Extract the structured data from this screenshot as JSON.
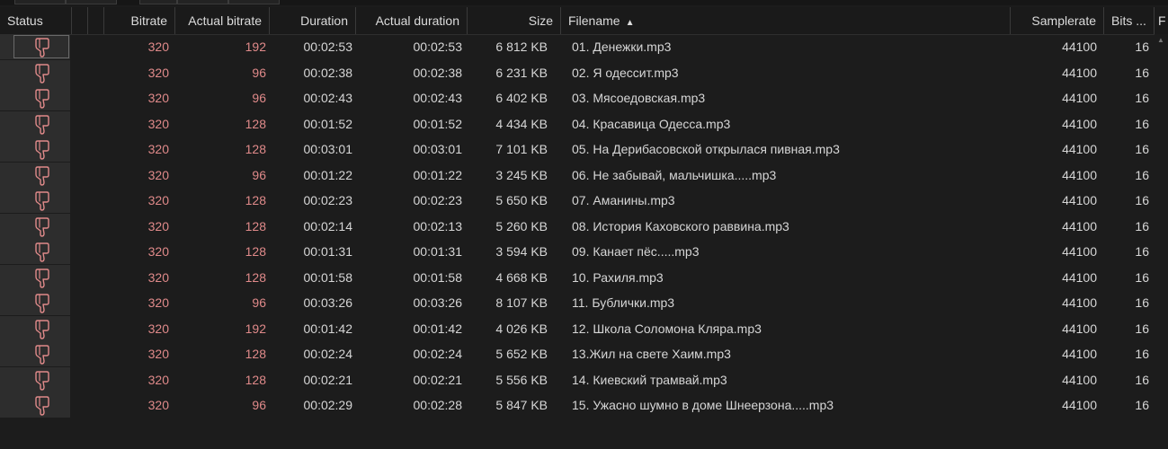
{
  "columns": {
    "status": "Status",
    "bitrate": "Bitrate",
    "actual_bitrate": "Actual bitrate",
    "duration": "Duration",
    "actual_duration": "Actual duration",
    "size": "Size",
    "filename": "Filename",
    "filename_sort": "▲",
    "samplerate": "Samplerate",
    "bits": "Bits ...",
    "overflow": "F"
  },
  "status_icon": "thumbs-down-icon",
  "colors": {
    "bitrate_text": "#e08a8a",
    "icon_stroke": "#e08a8a",
    "background": "#1c1c1c"
  },
  "rows": [
    {
      "bitrate": "320",
      "actual_bitrate": "192",
      "duration": "00:02:53",
      "actual_duration": "00:02:53",
      "size": "6 812 KB",
      "filename": "01. Денежки.mp3",
      "samplerate": "44100",
      "bits": "16"
    },
    {
      "bitrate": "320",
      "actual_bitrate": "96",
      "duration": "00:02:38",
      "actual_duration": "00:02:38",
      "size": "6 231 KB",
      "filename": "02. Я одессит.mp3",
      "samplerate": "44100",
      "bits": "16"
    },
    {
      "bitrate": "320",
      "actual_bitrate": "96",
      "duration": "00:02:43",
      "actual_duration": "00:02:43",
      "size": "6 402 KB",
      "filename": "03. Мясоедовская.mp3",
      "samplerate": "44100",
      "bits": "16"
    },
    {
      "bitrate": "320",
      "actual_bitrate": "128",
      "duration": "00:01:52",
      "actual_duration": "00:01:52",
      "size": "4 434 KB",
      "filename": "04. Красавица Одесса.mp3",
      "samplerate": "44100",
      "bits": "16"
    },
    {
      "bitrate": "320",
      "actual_bitrate": "128",
      "duration": "00:03:01",
      "actual_duration": "00:03:01",
      "size": "7 101 KB",
      "filename": "05. На Дерибасовской открылася пивная.mp3",
      "samplerate": "44100",
      "bits": "16"
    },
    {
      "bitrate": "320",
      "actual_bitrate": "96",
      "duration": "00:01:22",
      "actual_duration": "00:01:22",
      "size": "3 245 KB",
      "filename": "06. Не забывай, мальчишка.....mp3",
      "samplerate": "44100",
      "bits": "16"
    },
    {
      "bitrate": "320",
      "actual_bitrate": "128",
      "duration": "00:02:23",
      "actual_duration": "00:02:23",
      "size": "5 650 KB",
      "filename": "07. Аманины.mp3",
      "samplerate": "44100",
      "bits": "16"
    },
    {
      "bitrate": "320",
      "actual_bitrate": "128",
      "duration": "00:02:14",
      "actual_duration": "00:02:13",
      "size": "5 260 KB",
      "filename": "08. История Каховского раввина.mp3",
      "samplerate": "44100",
      "bits": "16"
    },
    {
      "bitrate": "320",
      "actual_bitrate": "128",
      "duration": "00:01:31",
      "actual_duration": "00:01:31",
      "size": "3 594 KB",
      "filename": "09. Канает пёс.....mp3",
      "samplerate": "44100",
      "bits": "16"
    },
    {
      "bitrate": "320",
      "actual_bitrate": "128",
      "duration": "00:01:58",
      "actual_duration": "00:01:58",
      "size": "4 668 KB",
      "filename": "10. Рахиля.mp3",
      "samplerate": "44100",
      "bits": "16"
    },
    {
      "bitrate": "320",
      "actual_bitrate": "96",
      "duration": "00:03:26",
      "actual_duration": "00:03:26",
      "size": "8 107 KB",
      "filename": "11. Бублички.mp3",
      "samplerate": "44100",
      "bits": "16"
    },
    {
      "bitrate": "320",
      "actual_bitrate": "192",
      "duration": "00:01:42",
      "actual_duration": "00:01:42",
      "size": "4 026 KB",
      "filename": "12. Школа Соломона Кляра.mp3",
      "samplerate": "44100",
      "bits": "16"
    },
    {
      "bitrate": "320",
      "actual_bitrate": "128",
      "duration": "00:02:24",
      "actual_duration": "00:02:24",
      "size": "5 652 KB",
      "filename": "13.Жил на свете Хаим.mp3",
      "samplerate": "44100",
      "bits": "16"
    },
    {
      "bitrate": "320",
      "actual_bitrate": "128",
      "duration": "00:02:21",
      "actual_duration": "00:02:21",
      "size": "5 556 KB",
      "filename": "14. Киевский трамвай.mp3",
      "samplerate": "44100",
      "bits": "16"
    },
    {
      "bitrate": "320",
      "actual_bitrate": "96",
      "duration": "00:02:29",
      "actual_duration": "00:02:28",
      "size": "5 847 KB",
      "filename": "15. Ужасно шумно в доме Шнеерзона.....mp3",
      "samplerate": "44100",
      "bits": "16"
    }
  ]
}
